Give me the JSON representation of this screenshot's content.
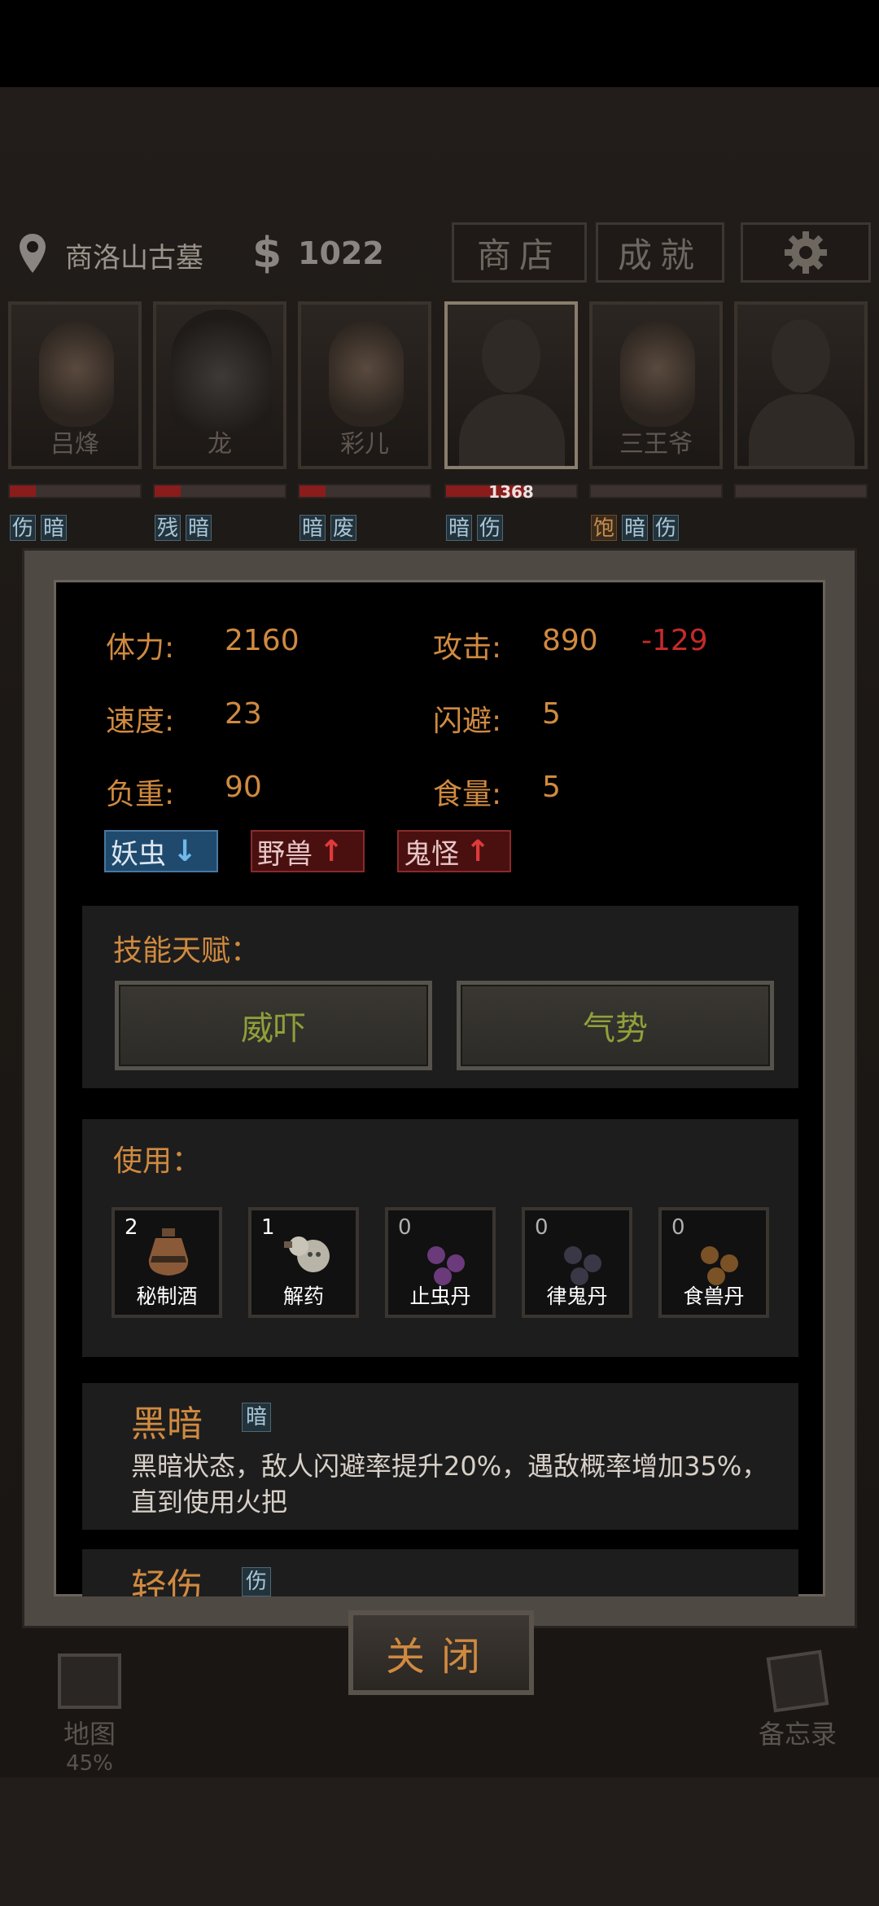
{
  "header": {
    "location": "商洛山古墓",
    "money_symbol": "$",
    "money": "1022",
    "shop_label": "商店",
    "achievements_label": "成就"
  },
  "party": [
    {
      "name": "吕烽",
      "hp_fraction": 0.2,
      "hp_text": "",
      "status": [
        "伤",
        "暗"
      ]
    },
    {
      "name": "龙",
      "hp_fraction": 0.2,
      "hp_text": "",
      "status": [
        "残",
        "暗"
      ]
    },
    {
      "name": "彩儿",
      "hp_fraction": 0.2,
      "hp_text": "",
      "status": [
        "暗",
        "废"
      ]
    },
    {
      "name": "",
      "hp_fraction": 0.6,
      "hp_text": "1368",
      "status": [
        "暗",
        "伤"
      ]
    },
    {
      "name": "三王爷",
      "hp_fraction": 0.0,
      "hp_text": "",
      "status": [
        "饱",
        "暗",
        "伤"
      ]
    },
    {
      "name": "",
      "hp_fraction": 0.0,
      "hp_text": "",
      "status": []
    }
  ],
  "stats": {
    "stamina_label": "体力:",
    "stamina": "2160",
    "attack_label": "攻击:",
    "attack": "890",
    "attack_mod": "-129",
    "speed_label": "速度:",
    "speed": "23",
    "dodge_label": "闪避:",
    "dodge": "5",
    "load_label": "负重:",
    "load": "90",
    "appetite_label": "食量:",
    "appetite": "5"
  },
  "affinities": [
    {
      "label": "妖虫",
      "dir": "down"
    },
    {
      "label": "野兽",
      "dir": "up"
    },
    {
      "label": "鬼怪",
      "dir": "up"
    }
  ],
  "skills": {
    "title": "技能天赋：",
    "items": [
      "威吓",
      "气势"
    ]
  },
  "use": {
    "title": "使用：",
    "items": [
      {
        "count": "2",
        "label": "秘制酒"
      },
      {
        "count": "1",
        "label": "解药"
      },
      {
        "count": "0",
        "label": "止虫丹"
      },
      {
        "count": "0",
        "label": "律鬼丹"
      },
      {
        "count": "0",
        "label": "食兽丹"
      }
    ]
  },
  "effects": [
    {
      "title": "黑暗",
      "chip": "暗",
      "text": "黑暗状态，敌人闪避率提升20%，遇敌概率增加35%，直到使用火把"
    },
    {
      "title": "轻伤",
      "chip": "伤",
      "text": ""
    }
  ],
  "close_label": "关闭",
  "bottom": {
    "map_label": "地图",
    "map_progress": "45%",
    "memo_label": "备忘录"
  }
}
